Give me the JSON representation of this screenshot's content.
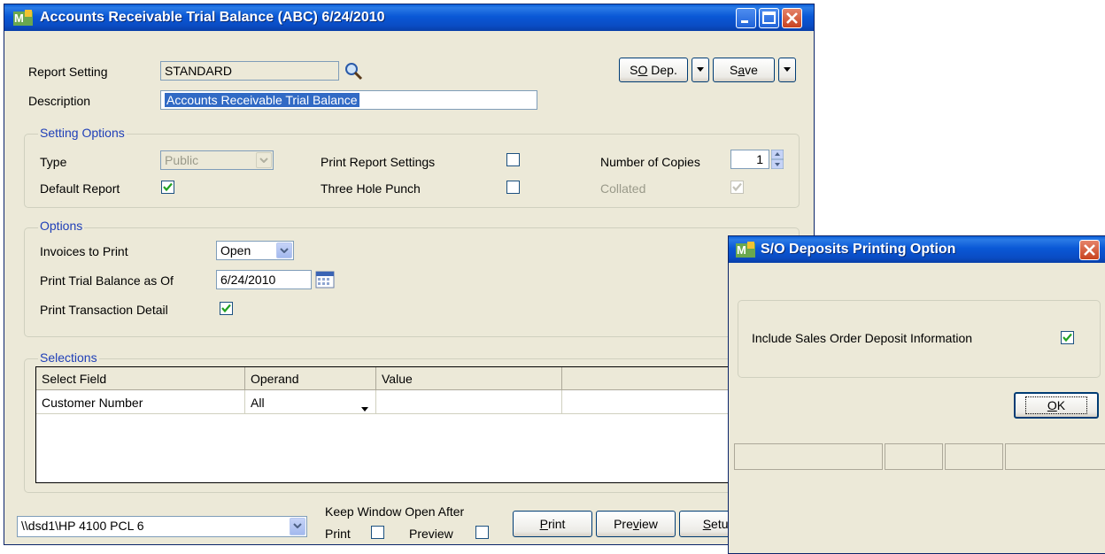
{
  "main_window": {
    "title": "Accounts Receivable Trial Balance (ABC) 6/24/2010",
    "report_setting_label": "Report Setting",
    "report_setting_value": "STANDARD",
    "description_label": "Description",
    "description_value": "Accounts Receivable Trial Balance",
    "so_dep_button": {
      "pre": "S",
      "u": "O",
      "post": " Dep."
    },
    "save_button": {
      "pre": "S",
      "u": "a",
      "post": "ve"
    },
    "setting_options": {
      "title": "Setting Options",
      "type_label": "Type",
      "type_value": "Public",
      "default_report_label": "Default Report",
      "default_report_checked": true,
      "print_report_settings_label": "Print Report Settings",
      "print_report_settings_checked": false,
      "three_hole_punch_label": "Three Hole Punch",
      "three_hole_punch_checked": false,
      "number_of_copies_label": "Number of Copies",
      "number_of_copies_value": "1",
      "collated_label": "Collated",
      "collated_checked": true
    },
    "options": {
      "title": "Options",
      "invoices_to_print_label": "Invoices to Print",
      "invoices_to_print_value": "Open",
      "print_trial_balance_label": "Print Trial Balance as Of",
      "print_trial_balance_value": "6/24/2010",
      "print_transaction_detail_label": "Print Transaction Detail",
      "print_transaction_detail_checked": true
    },
    "selections": {
      "title": "Selections",
      "columns": [
        "Select Field",
        "Operand",
        "Value"
      ],
      "rows": [
        {
          "select_field": "Customer Number",
          "operand": "All",
          "value": ""
        }
      ]
    },
    "printer_value": "\\\\dsd1\\HP 4100 PCL 6",
    "keep_open_label": "Keep Window Open After",
    "keep_open_print_label": "Print",
    "keep_open_print_checked": false,
    "keep_open_preview_label": "Preview",
    "keep_open_preview_checked": false,
    "print_button": {
      "pre": "",
      "u": "P",
      "post": "rint"
    },
    "preview_button": {
      "pre": "Pre",
      "u": "v",
      "post": "iew"
    },
    "setup_button": {
      "pre": "",
      "u": "S",
      "post": "etup"
    }
  },
  "dialog": {
    "title": "S/O Deposits Printing Option",
    "include_label": "Include Sales Order Deposit Information",
    "include_checked": true,
    "ok_button": {
      "pre": "",
      "u": "O",
      "post": "K"
    }
  },
  "colors": {
    "title_bar": "#0a58d6",
    "window_bg": "#ece9d8",
    "group_title": "#1f3fb8",
    "selection_highlight": "#316ac5",
    "check_mark": "#21a121",
    "close_button": "#c8421f"
  }
}
